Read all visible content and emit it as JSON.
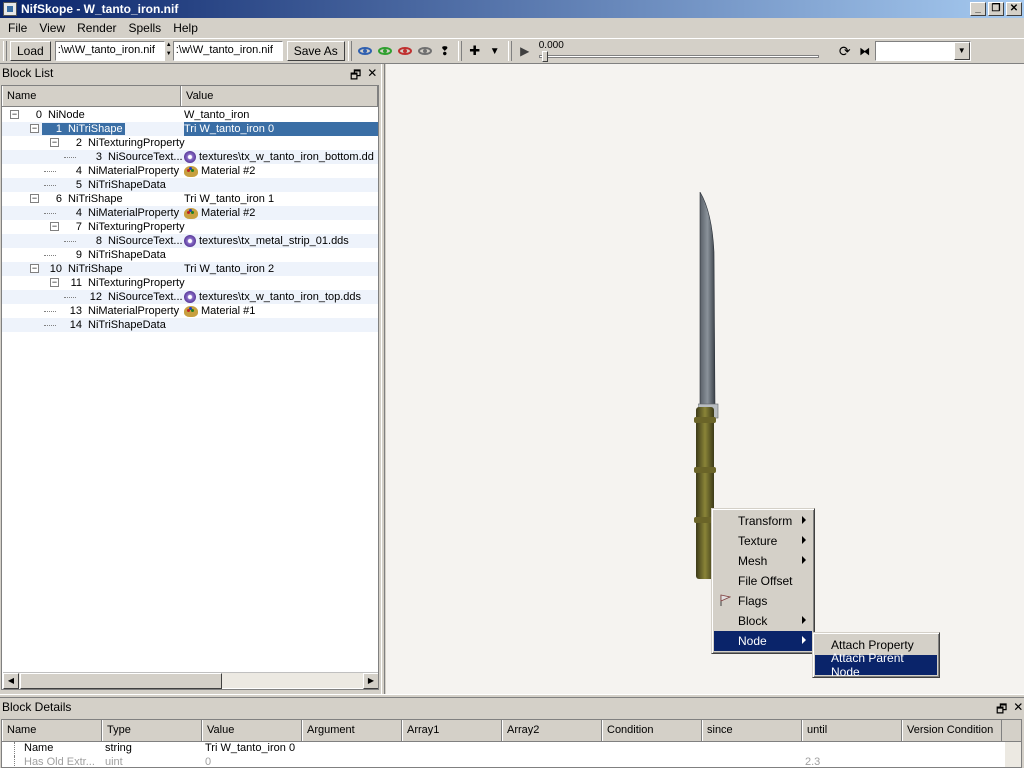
{
  "window": {
    "title": "NifSkope - W_tanto_iron.nif",
    "buttons": [
      "_",
      "❐",
      "✕"
    ]
  },
  "menu": [
    "File",
    "View",
    "Render",
    "Spells",
    "Help"
  ],
  "toolbar": {
    "load_label": "Load",
    "load_path": ":\\w\\W_tanto_iron.nif",
    "save_path": ":\\w\\W_tanto_iron.nif",
    "save_as_label": "Save As",
    "time_value": "0.000"
  },
  "block_list": {
    "title": "Block List",
    "columns": [
      "Name",
      "Value"
    ],
    "rows": [
      {
        "index": "0",
        "name": "NiNode",
        "value": "W_tanto_iron",
        "depth": 0,
        "expand": "⊟",
        "icon": ""
      },
      {
        "index": "1",
        "name": "NiTriShape",
        "value": "Tri W_tanto_iron 0",
        "depth": 1,
        "expand": "⊟",
        "icon": "",
        "selected": true
      },
      {
        "index": "2",
        "name": "NiTexturingProperty",
        "value": "",
        "depth": 2,
        "expand": "⊟",
        "icon": ""
      },
      {
        "index": "3",
        "name": "NiSourceText...",
        "value": "textures\\tx_w_tanto_iron_bottom.dd",
        "depth": 3,
        "expand": "",
        "icon": "texture"
      },
      {
        "index": "4",
        "name": "NiMaterialProperty",
        "value": "Material #2",
        "depth": 2,
        "expand": "",
        "icon": "material"
      },
      {
        "index": "5",
        "name": "NiTriShapeData",
        "value": "",
        "depth": 2,
        "expand": "",
        "icon": ""
      },
      {
        "index": "6",
        "name": "NiTriShape",
        "value": "Tri W_tanto_iron 1",
        "depth": 1,
        "expand": "⊟",
        "icon": ""
      },
      {
        "index": "4",
        "name": "NiMaterialProperty",
        "value": "Material #2",
        "depth": 2,
        "expand": "",
        "icon": "material"
      },
      {
        "index": "7",
        "name": "NiTexturingProperty",
        "value": "",
        "depth": 2,
        "expand": "⊟",
        "icon": ""
      },
      {
        "index": "8",
        "name": "NiSourceText...",
        "value": "textures\\tx_metal_strip_01.dds",
        "depth": 3,
        "expand": "",
        "icon": "texture"
      },
      {
        "index": "9",
        "name": "NiTriShapeData",
        "value": "",
        "depth": 2,
        "expand": "",
        "icon": ""
      },
      {
        "index": "10",
        "name": "NiTriShape",
        "value": "Tri W_tanto_iron 2",
        "depth": 1,
        "expand": "⊟",
        "icon": ""
      },
      {
        "index": "11",
        "name": "NiTexturingProperty",
        "value": "",
        "depth": 2,
        "expand": "⊟",
        "icon": ""
      },
      {
        "index": "12",
        "name": "NiSourceText...",
        "value": "textures\\tx_w_tanto_iron_top.dds",
        "depth": 3,
        "expand": "",
        "icon": "texture"
      },
      {
        "index": "13",
        "name": "NiMaterialProperty",
        "value": "Material #1",
        "depth": 2,
        "expand": "",
        "icon": "material"
      },
      {
        "index": "14",
        "name": "NiTriShapeData",
        "value": "",
        "depth": 2,
        "expand": "",
        "icon": ""
      }
    ]
  },
  "context_menu": {
    "items": [
      {
        "label": "Transform",
        "submenu": true
      },
      {
        "label": "Texture",
        "submenu": true
      },
      {
        "label": "Mesh",
        "submenu": true
      },
      {
        "label": "File Offset",
        "submenu": false
      },
      {
        "label": "Flags",
        "submenu": false,
        "icon": "flag-icon"
      },
      {
        "label": "Block",
        "submenu": true
      },
      {
        "label": "Node",
        "submenu": true,
        "highlighted": true
      }
    ]
  },
  "node_submenu": {
    "items": [
      {
        "label": "Attach Property",
        "highlighted": false
      },
      {
        "label": "Attach Parent Node",
        "highlighted": true
      }
    ]
  },
  "block_details": {
    "title": "Block Details",
    "columns": [
      "Name",
      "Type",
      "Value",
      "Argument",
      "Array1",
      "Array2",
      "Condition",
      "since",
      "until",
      "Version Condition"
    ],
    "rows": [
      {
        "name": "Name",
        "type": "string",
        "value": "Tri W_tanto_iron 0",
        "until": ""
      },
      {
        "name": "Has Old Extr...",
        "type": "uint",
        "value": "0",
        "until": "2.3",
        "dim": true
      }
    ]
  },
  "colors": {
    "selection": "#3a6ea5",
    "menu_highlight": "#0a246a",
    "viewport_bg": "#f5f3f0"
  }
}
